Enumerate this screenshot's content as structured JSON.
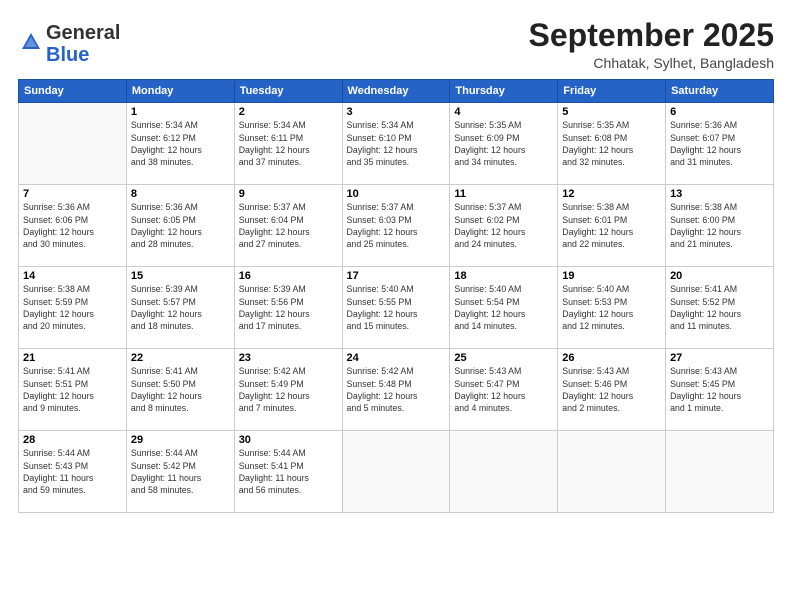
{
  "logo": {
    "general": "General",
    "blue": "Blue"
  },
  "header": {
    "month": "September 2025",
    "location": "Chhatak, Sylhet, Bangladesh"
  },
  "weekdays": [
    "Sunday",
    "Monday",
    "Tuesday",
    "Wednesday",
    "Thursday",
    "Friday",
    "Saturday"
  ],
  "weeks": [
    [
      {
        "day": "",
        "info": ""
      },
      {
        "day": "1",
        "info": "Sunrise: 5:34 AM\nSunset: 6:12 PM\nDaylight: 12 hours\nand 38 minutes."
      },
      {
        "day": "2",
        "info": "Sunrise: 5:34 AM\nSunset: 6:11 PM\nDaylight: 12 hours\nand 37 minutes."
      },
      {
        "day": "3",
        "info": "Sunrise: 5:34 AM\nSunset: 6:10 PM\nDaylight: 12 hours\nand 35 minutes."
      },
      {
        "day": "4",
        "info": "Sunrise: 5:35 AM\nSunset: 6:09 PM\nDaylight: 12 hours\nand 34 minutes."
      },
      {
        "day": "5",
        "info": "Sunrise: 5:35 AM\nSunset: 6:08 PM\nDaylight: 12 hours\nand 32 minutes."
      },
      {
        "day": "6",
        "info": "Sunrise: 5:36 AM\nSunset: 6:07 PM\nDaylight: 12 hours\nand 31 minutes."
      }
    ],
    [
      {
        "day": "7",
        "info": "Sunrise: 5:36 AM\nSunset: 6:06 PM\nDaylight: 12 hours\nand 30 minutes."
      },
      {
        "day": "8",
        "info": "Sunrise: 5:36 AM\nSunset: 6:05 PM\nDaylight: 12 hours\nand 28 minutes."
      },
      {
        "day": "9",
        "info": "Sunrise: 5:37 AM\nSunset: 6:04 PM\nDaylight: 12 hours\nand 27 minutes."
      },
      {
        "day": "10",
        "info": "Sunrise: 5:37 AM\nSunset: 6:03 PM\nDaylight: 12 hours\nand 25 minutes."
      },
      {
        "day": "11",
        "info": "Sunrise: 5:37 AM\nSunset: 6:02 PM\nDaylight: 12 hours\nand 24 minutes."
      },
      {
        "day": "12",
        "info": "Sunrise: 5:38 AM\nSunset: 6:01 PM\nDaylight: 12 hours\nand 22 minutes."
      },
      {
        "day": "13",
        "info": "Sunrise: 5:38 AM\nSunset: 6:00 PM\nDaylight: 12 hours\nand 21 minutes."
      }
    ],
    [
      {
        "day": "14",
        "info": "Sunrise: 5:38 AM\nSunset: 5:59 PM\nDaylight: 12 hours\nand 20 minutes."
      },
      {
        "day": "15",
        "info": "Sunrise: 5:39 AM\nSunset: 5:57 PM\nDaylight: 12 hours\nand 18 minutes."
      },
      {
        "day": "16",
        "info": "Sunrise: 5:39 AM\nSunset: 5:56 PM\nDaylight: 12 hours\nand 17 minutes."
      },
      {
        "day": "17",
        "info": "Sunrise: 5:40 AM\nSunset: 5:55 PM\nDaylight: 12 hours\nand 15 minutes."
      },
      {
        "day": "18",
        "info": "Sunrise: 5:40 AM\nSunset: 5:54 PM\nDaylight: 12 hours\nand 14 minutes."
      },
      {
        "day": "19",
        "info": "Sunrise: 5:40 AM\nSunset: 5:53 PM\nDaylight: 12 hours\nand 12 minutes."
      },
      {
        "day": "20",
        "info": "Sunrise: 5:41 AM\nSunset: 5:52 PM\nDaylight: 12 hours\nand 11 minutes."
      }
    ],
    [
      {
        "day": "21",
        "info": "Sunrise: 5:41 AM\nSunset: 5:51 PM\nDaylight: 12 hours\nand 9 minutes."
      },
      {
        "day": "22",
        "info": "Sunrise: 5:41 AM\nSunset: 5:50 PM\nDaylight: 12 hours\nand 8 minutes."
      },
      {
        "day": "23",
        "info": "Sunrise: 5:42 AM\nSunset: 5:49 PM\nDaylight: 12 hours\nand 7 minutes."
      },
      {
        "day": "24",
        "info": "Sunrise: 5:42 AM\nSunset: 5:48 PM\nDaylight: 12 hours\nand 5 minutes."
      },
      {
        "day": "25",
        "info": "Sunrise: 5:43 AM\nSunset: 5:47 PM\nDaylight: 12 hours\nand 4 minutes."
      },
      {
        "day": "26",
        "info": "Sunrise: 5:43 AM\nSunset: 5:46 PM\nDaylight: 12 hours\nand 2 minutes."
      },
      {
        "day": "27",
        "info": "Sunrise: 5:43 AM\nSunset: 5:45 PM\nDaylight: 12 hours\nand 1 minute."
      }
    ],
    [
      {
        "day": "28",
        "info": "Sunrise: 5:44 AM\nSunset: 5:43 PM\nDaylight: 11 hours\nand 59 minutes."
      },
      {
        "day": "29",
        "info": "Sunrise: 5:44 AM\nSunset: 5:42 PM\nDaylight: 11 hours\nand 58 minutes."
      },
      {
        "day": "30",
        "info": "Sunrise: 5:44 AM\nSunset: 5:41 PM\nDaylight: 11 hours\nand 56 minutes."
      },
      {
        "day": "",
        "info": ""
      },
      {
        "day": "",
        "info": ""
      },
      {
        "day": "",
        "info": ""
      },
      {
        "day": "",
        "info": ""
      }
    ]
  ]
}
